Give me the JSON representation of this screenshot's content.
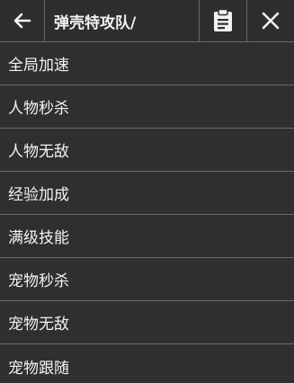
{
  "header": {
    "title": "弹壳特攻队/",
    "icons": [
      "back-arrow-icon",
      "clipboard-icon",
      "close-icon"
    ]
  },
  "menu": {
    "items": [
      {
        "label": "全局加速"
      },
      {
        "label": "人物秒杀"
      },
      {
        "label": "人物无敌"
      },
      {
        "label": "经验加成"
      },
      {
        "label": "满级技能"
      },
      {
        "label": "宠物秒杀"
      },
      {
        "label": "宠物无敌"
      },
      {
        "label": "宠物跟随"
      }
    ]
  },
  "colors": {
    "background": "#2f2f2f",
    "divider": "#6a6a6a",
    "text": "#f2f2f2"
  }
}
